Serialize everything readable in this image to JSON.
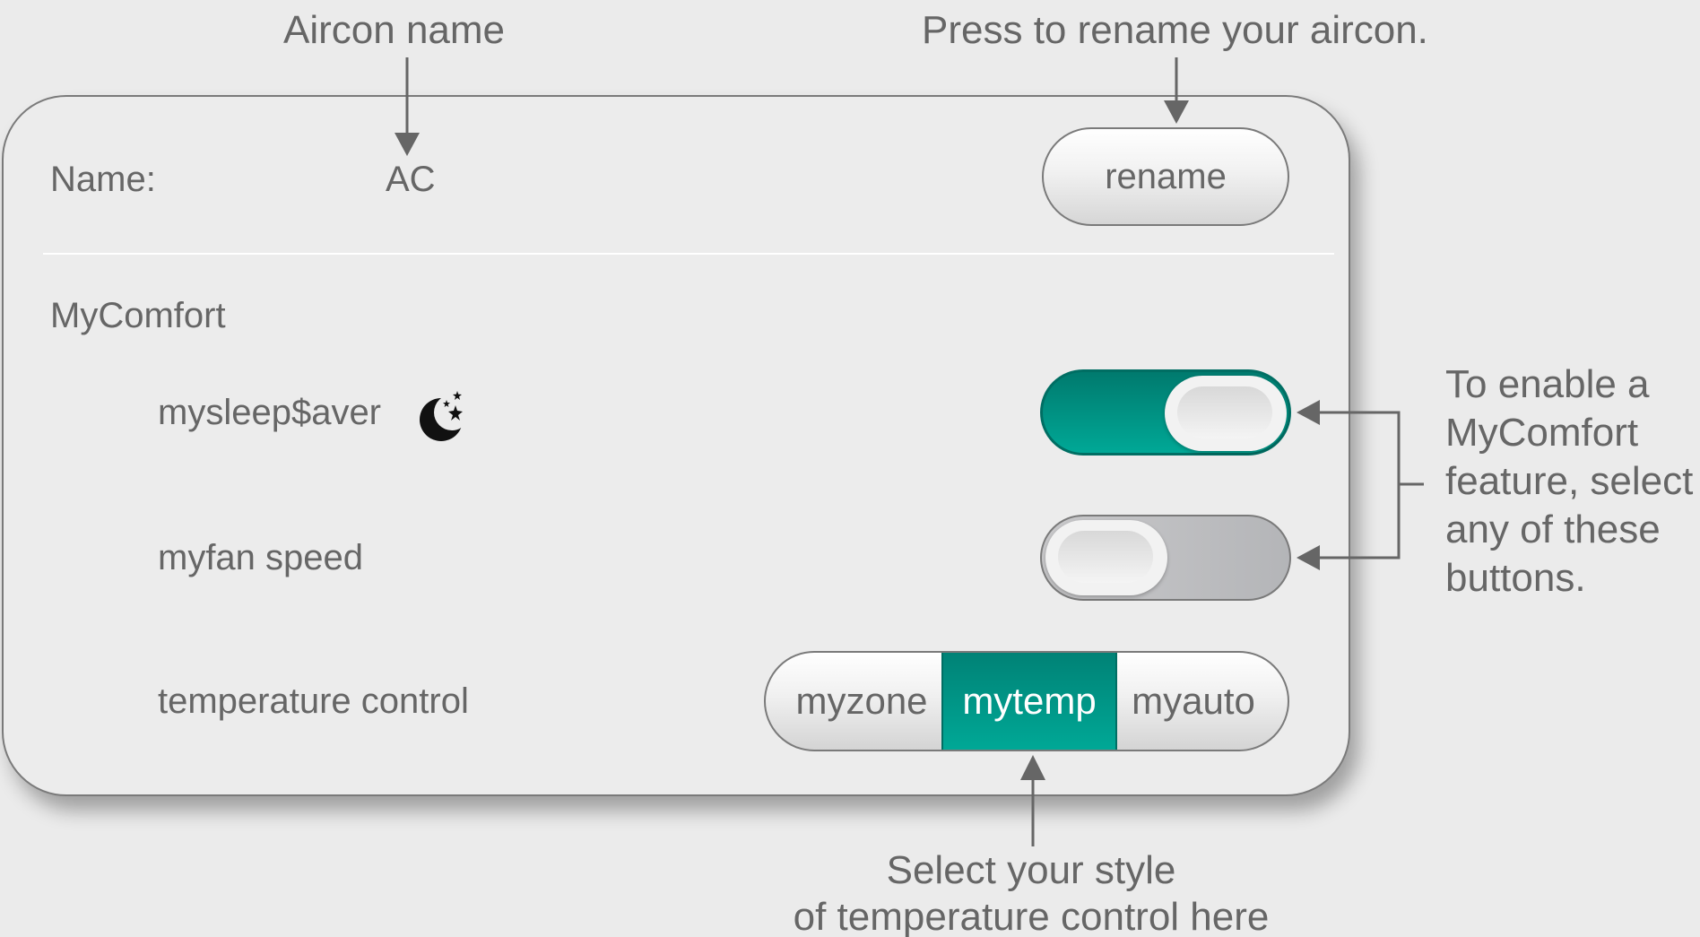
{
  "annotations": {
    "aircon_name": "Aircon name",
    "rename_hint": "Press to rename your aircon.",
    "mycomfort_hint_lines": [
      "To enable a",
      "MyComfort",
      "feature, select",
      "any of these",
      "buttons."
    ],
    "temp_style_hint_lines": [
      "Select your style",
      "of temperature control here"
    ]
  },
  "panel": {
    "name_label": "Name:",
    "name_value": "AC",
    "rename_button": "rename",
    "section_title": "MyComfort",
    "features": {
      "sleep_saver": {
        "label": "mysleep$aver",
        "icon": "moon-stars-icon",
        "enabled": true
      },
      "fan_speed": {
        "label": "myfan speed",
        "enabled": false
      }
    },
    "temperature_control": {
      "label": "temperature control",
      "options": [
        "myzone",
        "mytemp",
        "myauto"
      ],
      "selected": "mytemp"
    }
  },
  "colors": {
    "accent": "#00a896",
    "accent_dark": "#007a6e",
    "text": "#666666",
    "background": "#ebebeb",
    "toggle_off": "#b4b5b8"
  }
}
